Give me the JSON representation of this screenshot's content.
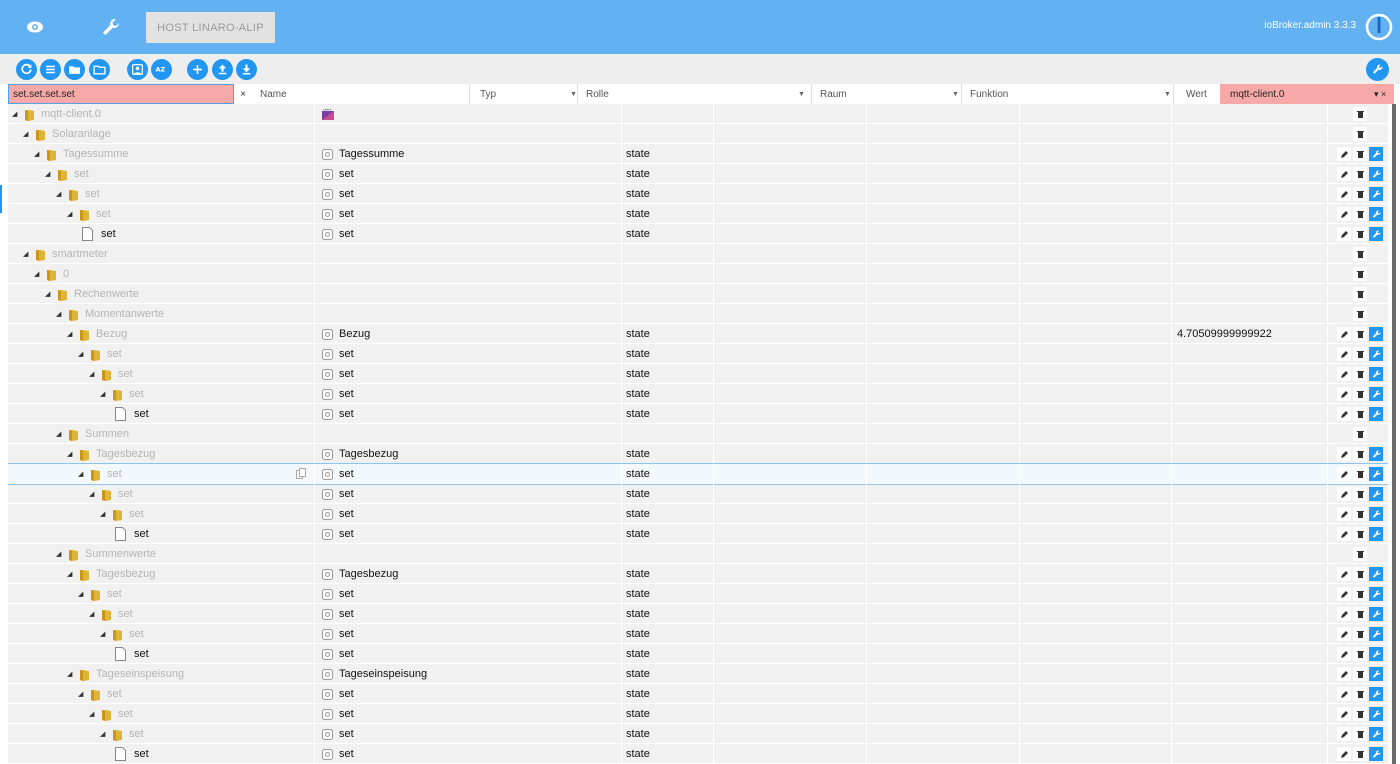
{
  "header": {
    "host_button": "HOST LINARO-ALIP",
    "version": "ioBroker.admin 3.3.3"
  },
  "toolbar": {
    "buttons": [
      "refresh-icon",
      "list-icon",
      "folder-icon",
      "folder-open-icon",
      "person-icon",
      "sort-az-icon",
      "add-icon",
      "upload-icon",
      "download-icon"
    ],
    "right_button": "wrench-icon"
  },
  "filters": {
    "id_value": "set.set.set.set",
    "clear": "×",
    "name_placeholder": "Name",
    "typ": "Typ",
    "rolle": "Rolle",
    "raum": "Raum",
    "funktion": "Funktion",
    "wert": "Wert",
    "instance": "mqtt-client.0",
    "instance_controls": "▾ ×"
  },
  "colors": {
    "header_bg": "#62b2f3",
    "accent": "#2196f3",
    "filter_active": "#f7a9a7"
  },
  "rows": [
    {
      "label": "mqtt-client.0",
      "kind": "folder",
      "level": 0,
      "name": "",
      "role": "",
      "value": "",
      "buttons": "del",
      "logo": true
    },
    {
      "label": "Solaranlage",
      "kind": "folder",
      "level": 1,
      "name": "",
      "role": "",
      "value": "",
      "buttons": "del"
    },
    {
      "label": "Tagessumme",
      "kind": "folder",
      "level": 2,
      "name": "Tagessumme",
      "role": "state",
      "value": "",
      "buttons": "all"
    },
    {
      "label": "set",
      "kind": "folder",
      "level": 3,
      "name": "set",
      "role": "state",
      "value": "",
      "buttons": "all"
    },
    {
      "label": "set",
      "kind": "folder",
      "level": 4,
      "name": "set",
      "role": "state",
      "value": "",
      "buttons": "all"
    },
    {
      "label": "set",
      "kind": "folder",
      "level": 5,
      "name": "set",
      "role": "state",
      "value": "",
      "buttons": "all"
    },
    {
      "label": "set",
      "kind": "file",
      "level": 6,
      "name": "set",
      "role": "state",
      "value": "",
      "buttons": "all"
    },
    {
      "label": "smartmeter",
      "kind": "folder",
      "level": 1,
      "name": "",
      "role": "",
      "value": "",
      "buttons": "del"
    },
    {
      "label": "0",
      "kind": "folder",
      "level": 2,
      "name": "",
      "role": "",
      "value": "",
      "buttons": "del"
    },
    {
      "label": "Rechenwerte",
      "kind": "folder",
      "level": 3,
      "name": "",
      "role": "",
      "value": "",
      "buttons": "del"
    },
    {
      "label": "Momentanwerte",
      "kind": "folder",
      "level": 4,
      "name": "",
      "role": "",
      "value": "",
      "buttons": "del"
    },
    {
      "label": "Bezug",
      "kind": "folder",
      "level": 5,
      "name": "Bezug",
      "role": "state",
      "value": "4.70509999999922",
      "buttons": "all"
    },
    {
      "label": "set",
      "kind": "folder",
      "level": 6,
      "name": "set",
      "role": "state",
      "value": "",
      "buttons": "all"
    },
    {
      "label": "set",
      "kind": "folder",
      "level": 7,
      "name": "set",
      "role": "state",
      "value": "",
      "buttons": "all"
    },
    {
      "label": "set",
      "kind": "folder",
      "level": 8,
      "name": "set",
      "role": "state",
      "value": "",
      "buttons": "all"
    },
    {
      "label": "set",
      "kind": "file",
      "level": 9,
      "name": "set",
      "role": "state",
      "value": "",
      "buttons": "all"
    },
    {
      "label": "Summen",
      "kind": "folder",
      "level": 4,
      "name": "",
      "role": "",
      "value": "",
      "buttons": "del"
    },
    {
      "label": "Tagesbezug",
      "kind": "folder",
      "level": 5,
      "name": "Tagesbezug",
      "role": "state",
      "value": "",
      "buttons": "all"
    },
    {
      "label": "set",
      "kind": "folder",
      "level": 6,
      "name": "set",
      "role": "state",
      "value": "",
      "buttons": "all",
      "selected": true
    },
    {
      "label": "set",
      "kind": "folder",
      "level": 7,
      "name": "set",
      "role": "state",
      "value": "",
      "buttons": "all"
    },
    {
      "label": "set",
      "kind": "folder",
      "level": 8,
      "name": "set",
      "role": "state",
      "value": "",
      "buttons": "all"
    },
    {
      "label": "set",
      "kind": "file",
      "level": 9,
      "name": "set",
      "role": "state",
      "value": "",
      "buttons": "all"
    },
    {
      "label": "Summenwerte",
      "kind": "folder",
      "level": 4,
      "name": "",
      "role": "",
      "value": "",
      "buttons": "del"
    },
    {
      "label": "Tagesbezug",
      "kind": "folder",
      "level": 5,
      "name": "Tagesbezug",
      "role": "state",
      "value": "",
      "buttons": "all"
    },
    {
      "label": "set",
      "kind": "folder",
      "level": 6,
      "name": "set",
      "role": "state",
      "value": "",
      "buttons": "all"
    },
    {
      "label": "set",
      "kind": "folder",
      "level": 7,
      "name": "set",
      "role": "state",
      "value": "",
      "buttons": "all"
    },
    {
      "label": "set",
      "kind": "folder",
      "level": 8,
      "name": "set",
      "role": "state",
      "value": "",
      "buttons": "all"
    },
    {
      "label": "set",
      "kind": "file",
      "level": 9,
      "name": "set",
      "role": "state",
      "value": "",
      "buttons": "all"
    },
    {
      "label": "Tageseinspeisung",
      "kind": "folder",
      "level": 5,
      "name": "Tageseinspeisung",
      "role": "state",
      "value": "",
      "buttons": "all"
    },
    {
      "label": "set",
      "kind": "folder",
      "level": 6,
      "name": "set",
      "role": "state",
      "value": "",
      "buttons": "all"
    },
    {
      "label": "set",
      "kind": "folder",
      "level": 7,
      "name": "set",
      "role": "state",
      "value": "",
      "buttons": "all"
    },
    {
      "label": "set",
      "kind": "folder",
      "level": 8,
      "name": "set",
      "role": "state",
      "value": "",
      "buttons": "all"
    },
    {
      "label": "set",
      "kind": "file",
      "level": 9,
      "name": "set",
      "role": "state",
      "value": "",
      "buttons": "all"
    }
  ]
}
